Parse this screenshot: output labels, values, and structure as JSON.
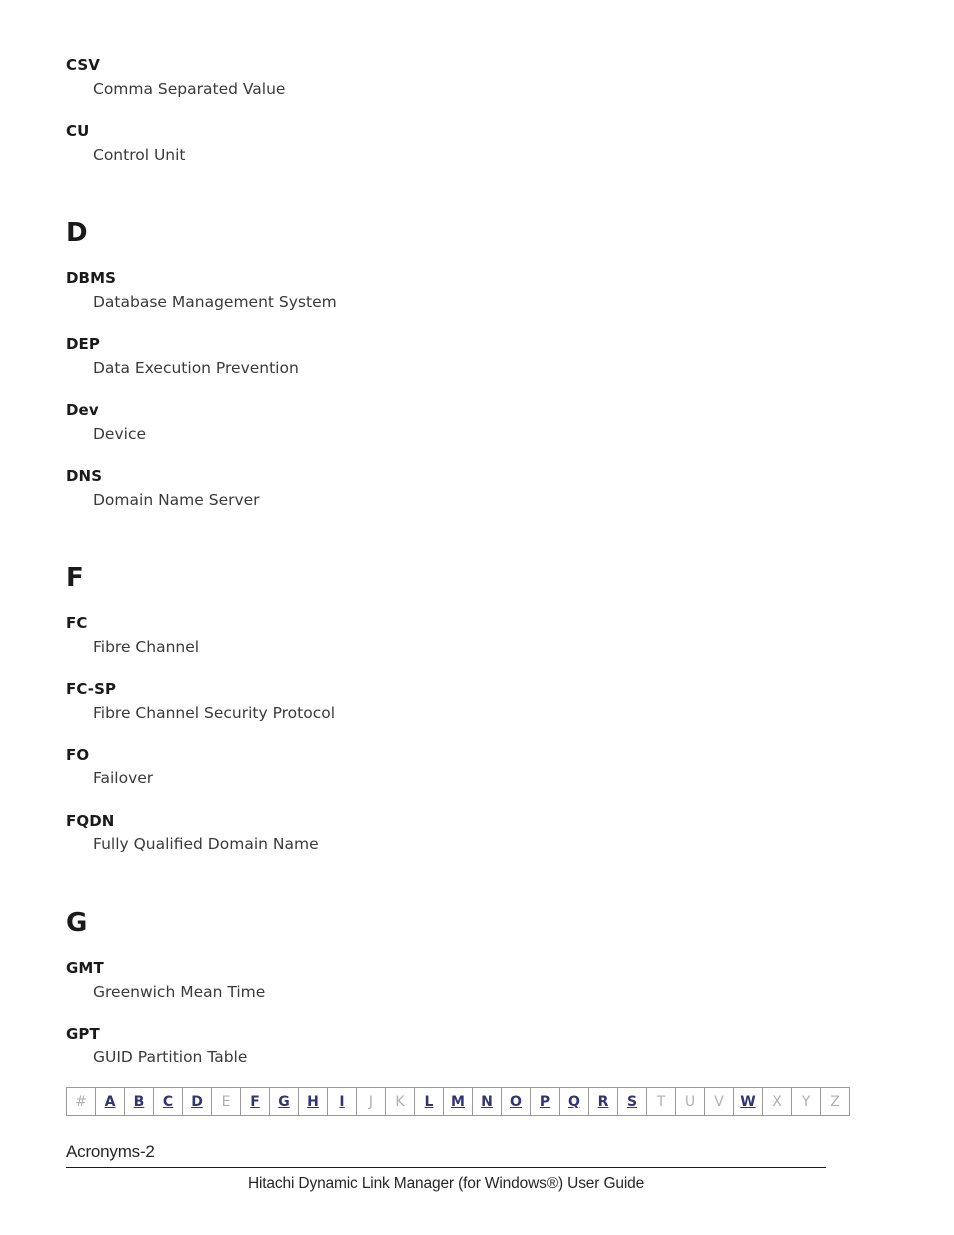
{
  "document": {
    "page_label": "Acronyms-2",
    "footer_title": "Hitachi Dynamic Link Manager (for Windows®) User Guide"
  },
  "colors": {
    "link": "#333377",
    "disabled": "#b0b0b0",
    "term": "#1a1a1a",
    "body": "#3a3a3a",
    "rule": "#1a1a1a"
  },
  "glossary": {
    "continued_entries": [
      {
        "term": "CSV",
        "definition": "Comma Separated Value"
      },
      {
        "term": "CU",
        "definition": "Control Unit"
      }
    ],
    "sections": [
      {
        "letter": "D",
        "entries": [
          {
            "term": "DBMS",
            "definition": "Database Management System"
          },
          {
            "term": "DEP",
            "definition": "Data Execution Prevention"
          },
          {
            "term": "Dev",
            "definition": "Device"
          },
          {
            "term": "DNS",
            "definition": "Domain Name Server"
          }
        ]
      },
      {
        "letter": "F",
        "entries": [
          {
            "term": "FC",
            "definition": "Fibre Channel"
          },
          {
            "term": "FC-SP",
            "definition": "Fibre Channel Security Protocol"
          },
          {
            "term": "FO",
            "definition": "Failover"
          },
          {
            "term": "FQDN",
            "definition": "Fully Qualified Domain Name"
          }
        ]
      },
      {
        "letter": "G",
        "entries": [
          {
            "term": "GMT",
            "definition": "Greenwich Mean Time"
          },
          {
            "term": "GPT",
            "definition": "GUID Partition Table"
          }
        ]
      }
    ]
  },
  "alpha_nav": {
    "items": [
      {
        "label": "#",
        "active": false
      },
      {
        "label": "A",
        "active": true
      },
      {
        "label": "B",
        "active": true
      },
      {
        "label": "C",
        "active": true
      },
      {
        "label": "D",
        "active": true
      },
      {
        "label": "E",
        "active": false
      },
      {
        "label": "F",
        "active": true
      },
      {
        "label": "G",
        "active": true
      },
      {
        "label": "H",
        "active": true
      },
      {
        "label": "I",
        "active": true
      },
      {
        "label": "J",
        "active": false
      },
      {
        "label": "K",
        "active": false
      },
      {
        "label": "L",
        "active": true
      },
      {
        "label": "M",
        "active": true
      },
      {
        "label": "N",
        "active": true
      },
      {
        "label": "O",
        "active": true
      },
      {
        "label": "P",
        "active": true
      },
      {
        "label": "Q",
        "active": true
      },
      {
        "label": "R",
        "active": true
      },
      {
        "label": "S",
        "active": true
      },
      {
        "label": "T",
        "active": false
      },
      {
        "label": "U",
        "active": false
      },
      {
        "label": "V",
        "active": false
      },
      {
        "label": "W",
        "active": true
      },
      {
        "label": "X",
        "active": false
      },
      {
        "label": "Y",
        "active": false
      },
      {
        "label": "Z",
        "active": false
      }
    ]
  }
}
